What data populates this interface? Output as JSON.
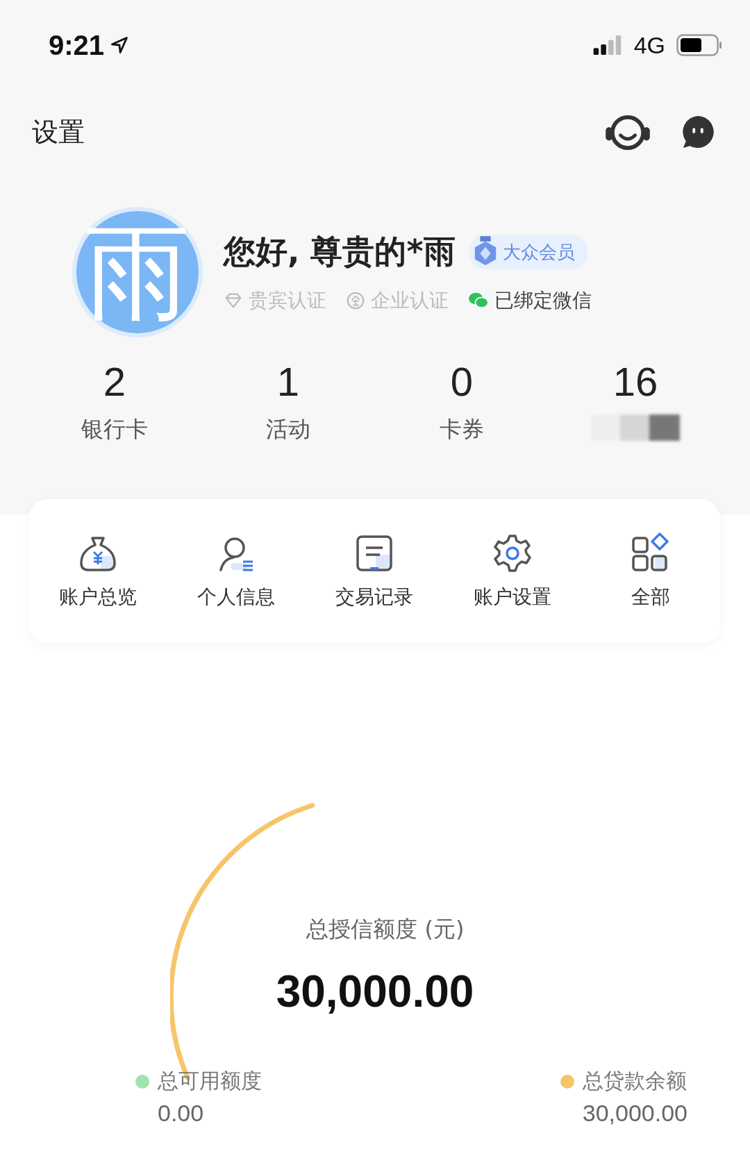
{
  "status_bar": {
    "time": "9:21",
    "network": "4G"
  },
  "header": {
    "title": "设置"
  },
  "profile": {
    "avatar_char": "雨",
    "greeting": "您好, 尊贵的*雨",
    "member_badge": "大众会员",
    "certifications": [
      {
        "kind": "vip",
        "label": "贵宾认证",
        "verified": false
      },
      {
        "kind": "enterprise",
        "label": "企业认证",
        "verified": false
      },
      {
        "kind": "wechat",
        "label": "已绑定微信",
        "verified": true
      }
    ]
  },
  "stats": [
    {
      "value": "2",
      "label": "银行卡"
    },
    {
      "value": "1",
      "label": "活动"
    },
    {
      "value": "0",
      "label": "卡券"
    },
    {
      "value": "16"
    }
  ],
  "shortcuts": [
    {
      "kind": "overview",
      "label": "账户总览"
    },
    {
      "kind": "profile",
      "label": "个人信息"
    },
    {
      "kind": "records",
      "label": "交易记录"
    },
    {
      "kind": "settings",
      "label": "账户设置"
    },
    {
      "kind": "all",
      "label": "全部"
    }
  ],
  "credit": {
    "title": "总授信额度 (元)",
    "total": "30,000.00",
    "legend": [
      {
        "label": "总可用额度",
        "value": "0.00",
        "color": "#9ee3b0"
      },
      {
        "label": "总贷款余额",
        "value": "30,000.00",
        "color": "#f6c56a"
      }
    ]
  }
}
